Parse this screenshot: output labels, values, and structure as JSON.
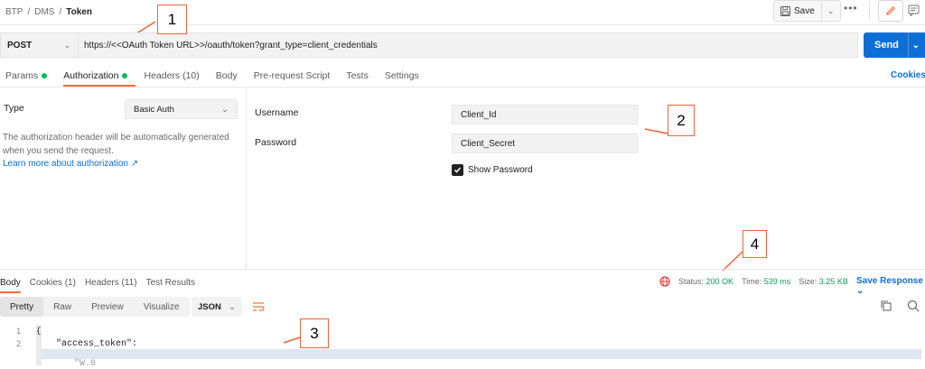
{
  "breadcrumb": {
    "parts": [
      "BTP",
      "DMS"
    ],
    "current": "Token",
    "separator": "/"
  },
  "toolbar": {
    "save_label": "Save",
    "more_label": "•••"
  },
  "request": {
    "method": "POST",
    "url": "https://<<OAuth Token URL>>/oauth/token?grant_type=client_credentials",
    "send_label": "Send"
  },
  "tabs": {
    "params": "Params",
    "authorization": "Authorization",
    "headers": "Headers (10)",
    "body": "Body",
    "prerequest": "Pre-request Script",
    "tests": "Tests",
    "settings": "Settings",
    "cookies": "Cookies"
  },
  "auth": {
    "type_label": "Type",
    "type_value": "Basic Auth",
    "desc_line1": "The authorization header will be automatically generated",
    "desc_line2": "when you send the request.",
    "learn_more": "Learn more about authorization ↗",
    "username_label": "Username",
    "username_value": "Client_Id",
    "password_label": "Password",
    "password_value": "Client_Secret",
    "show_password_label": "Show Password",
    "show_password_checked": true
  },
  "callouts": {
    "one": "1",
    "two": "2",
    "three": "3",
    "four": "4"
  },
  "response": {
    "tabs": {
      "body": "Body",
      "cookies": "Cookies (1)",
      "headers": "Headers (11)",
      "test_results": "Test Results"
    },
    "status_label": "Status:",
    "status_value": "200 OK",
    "time_label": "Time:",
    "time_value": "539 ms",
    "size_label": "Size:",
    "size_value": "3.25 KB",
    "save_response": "Save Response",
    "views": {
      "pretty": "Pretty",
      "raw": "Raw",
      "preview": "Preview",
      "visualize": "Visualize"
    },
    "format": "JSON",
    "lines": [
      {
        "n": "1",
        "text": "{"
      },
      {
        "n": "2",
        "text": "\"access_token\":"
      }
    ],
    "partial_line": "\"W.0"
  },
  "colors": {
    "accent": "#ff6c37",
    "primary": "#0d6fd6",
    "success": "#0cbb52",
    "callout": "#f0623c"
  }
}
